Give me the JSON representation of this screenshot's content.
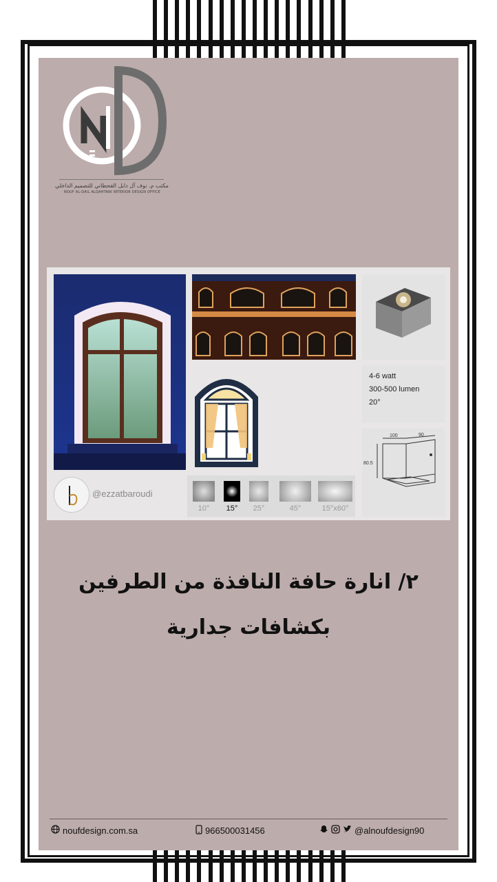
{
  "brand": {
    "logo_letters": "ND",
    "name_ar": "مكتب م. نوف آل دايل القحطاني للتصميم الداخلي",
    "name_en": "NOUF AL-DAIL ALQAHTANI INTERIOR DESIGN OFFICE"
  },
  "card": {
    "specs": [
      "4-6 watt",
      "300-500 lumen",
      "20°"
    ],
    "dims": {
      "width": "100",
      "depth": "90",
      "height": "80.5"
    },
    "signature_handle": "@ezzatbaroudi",
    "signature_letter": "b",
    "beams": [
      {
        "label": "10°",
        "active": false
      },
      {
        "label": "15°",
        "active": true
      },
      {
        "label": "25°",
        "active": false
      },
      {
        "label": "45°",
        "active": false
      },
      {
        "label": "15°x60°",
        "active": false
      }
    ]
  },
  "headline": {
    "line1": "٢/ انارة حافة النافذة من الطرفين",
    "line2": "بكشافات جدارية"
  },
  "footer": {
    "website": "noufdesign.com.sa",
    "phone": "966500031456",
    "social": "@alnoufdesign90"
  },
  "colors": {
    "panel": "#bcacab",
    "frame": "#111111",
    "card": "#e8e6e6"
  }
}
